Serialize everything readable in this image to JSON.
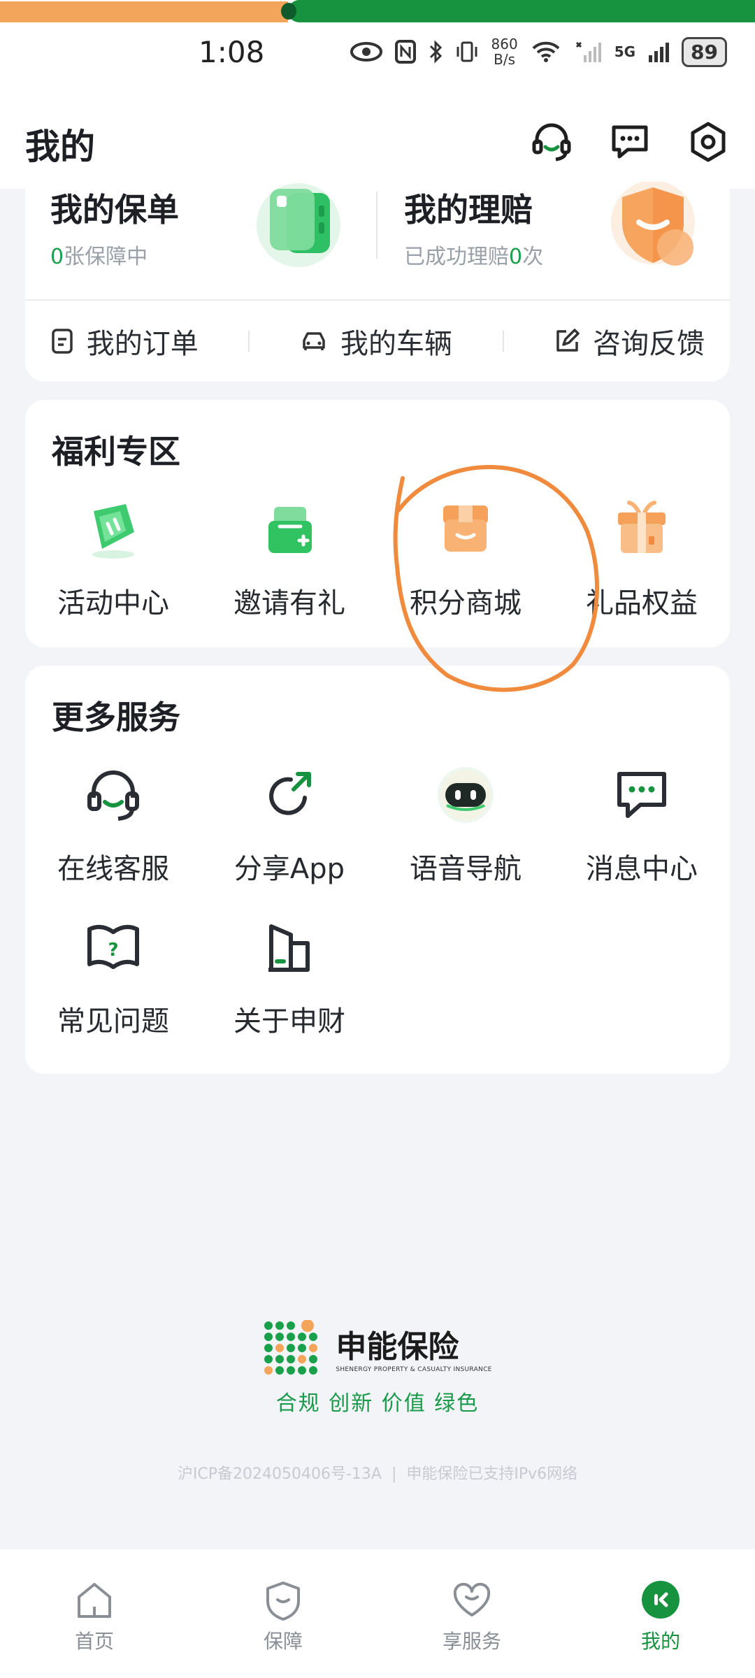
{
  "status_bar": {
    "time": "1:08",
    "net_speed_value": "860",
    "net_speed_unit": "B/s",
    "network": "5G",
    "battery": "89"
  },
  "header": {
    "title": "我的",
    "icons": [
      "headset-icon",
      "message-icon",
      "settings-icon"
    ]
  },
  "policy_card": {
    "my_policy": {
      "title": "我的保单",
      "count": "0",
      "count_suffix": "张保障中"
    },
    "my_claims": {
      "title": "我的理赔",
      "prefix": "已成功理赔",
      "count": "0",
      "suffix": "次"
    },
    "quick_links": [
      {
        "label": "我的订单",
        "icon": "document-icon"
      },
      {
        "label": "我的车辆",
        "icon": "car-icon"
      },
      {
        "label": "咨询反馈",
        "icon": "edit-icon"
      }
    ]
  },
  "benefits": {
    "title": "福利专区",
    "items": [
      {
        "label": "活动中心",
        "icon": "ticket-icon"
      },
      {
        "label": "邀请有礼",
        "icon": "invite-icon"
      },
      {
        "label": "积分商城",
        "icon": "store-box-icon"
      },
      {
        "label": "礼品权益",
        "icon": "gift-icon"
      }
    ]
  },
  "more_services": {
    "title": "更多服务",
    "items": [
      {
        "label": "在线客服",
        "icon": "headset-icon"
      },
      {
        "label": "分享App",
        "icon": "share-icon"
      },
      {
        "label": "语音导航",
        "icon": "robot-icon"
      },
      {
        "label": "消息中心",
        "icon": "message-icon"
      },
      {
        "label": "常见问题",
        "icon": "faq-book-icon"
      },
      {
        "label": "关于申财",
        "icon": "building-icon"
      }
    ]
  },
  "footer": {
    "brand_name": "申能保险",
    "brand_english": "SHENERGY PROPERTY & CASUALTY INSURANCE",
    "slogan": "合规 创新 价值 绿色",
    "icp": "沪ICP备2024050406号-13A",
    "ipv6": "申能保险已支持IPv6网络"
  },
  "tab_bar": {
    "tabs": [
      {
        "label": "首页",
        "icon": "home-icon",
        "active": false
      },
      {
        "label": "保障",
        "icon": "shield-icon",
        "active": false
      },
      {
        "label": "享服务",
        "icon": "heart-icon",
        "active": false
      },
      {
        "label": "我的",
        "icon": "profile-icon",
        "active": true
      }
    ]
  },
  "colors": {
    "brand_green": "#17923f",
    "accent_orange": "#f3a55b",
    "annotation_orange": "#f08a3c"
  }
}
